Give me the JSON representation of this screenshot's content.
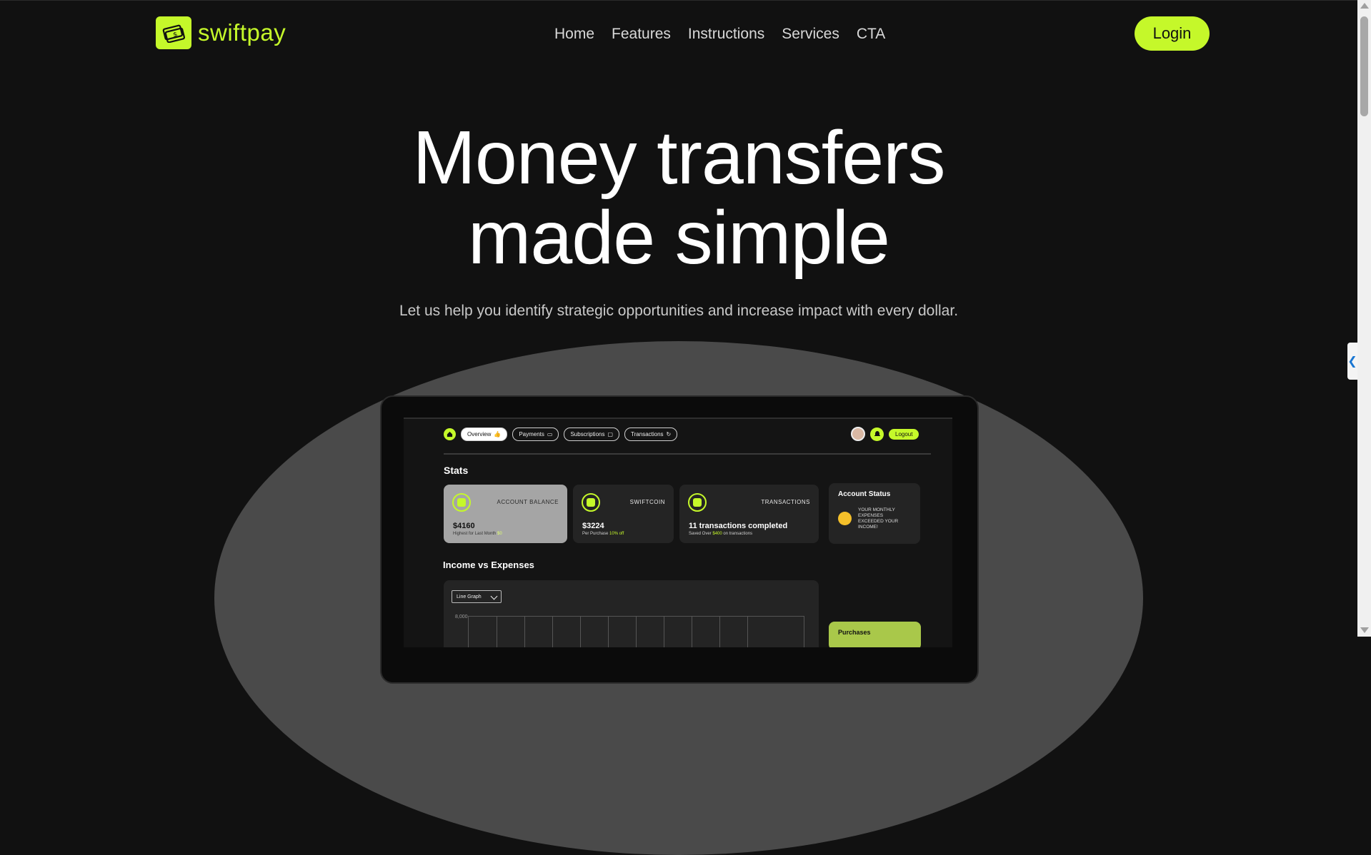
{
  "brand": {
    "name": "swiftpay",
    "color": "#c5f82a",
    "icon": "money-icon"
  },
  "nav": {
    "items": [
      "Home",
      "Features",
      "Instructions",
      "Services",
      "CTA"
    ]
  },
  "header": {
    "login_label": "Login"
  },
  "hero": {
    "title_line1": "Money transfers",
    "title_line2": "made simple",
    "subtitle": "Let us help you identify strategic opportunities and increase impact with every dollar."
  },
  "dashboard": {
    "tabs": [
      "Overview",
      "Payments",
      "Subscriptions",
      "Transactions"
    ],
    "logout_label": "Logout",
    "stats_heading": "Stats",
    "cards": [
      {
        "label": "ACCOUNT BALANCE",
        "value": "$4160",
        "note": "Highest for Last Month",
        "note_highlight": "$0"
      },
      {
        "label": "SWIFTCOIN",
        "value": "$3224",
        "note": "Per Purchase",
        "note_highlight": "10% off"
      },
      {
        "label": "TRANSACTIONS",
        "value": "11 transactions completed",
        "note": "Saved Over",
        "note_highlight": "$400",
        "note_suffix": "on transactions"
      }
    ],
    "account_status": {
      "title": "Account Status",
      "message": "YOUR MONTHLY EXPENSES EXCEEDED YOUR INCOME!"
    },
    "income_heading": "Income vs Expenses",
    "graph_select": "Line Graph",
    "graph_y_tick": "8,000",
    "purchases_label": "Purchases"
  }
}
